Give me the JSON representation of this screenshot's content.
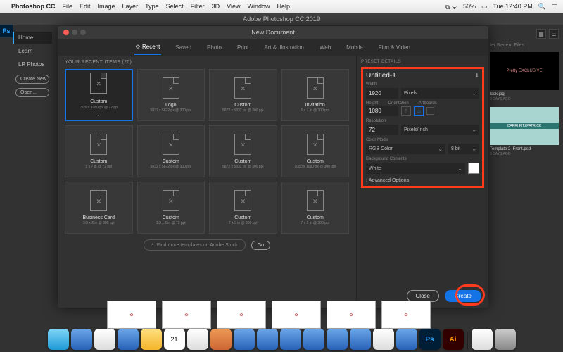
{
  "menubar": {
    "app": "Photoshop CC",
    "items": [
      "File",
      "Edit",
      "Image",
      "Layer",
      "Type",
      "Select",
      "Filter",
      "3D",
      "View",
      "Window",
      "Help"
    ],
    "battery": "50%",
    "time": "Tue 12:40 PM"
  },
  "titlebar": "Adobe Photoshop CC 2019",
  "sidebar": {
    "tabs": [
      "Home",
      "Learn",
      "LR Photos"
    ],
    "create": "Create New",
    "open": "Open..."
  },
  "dialog": {
    "title": "New Document",
    "tabs": [
      "Recent",
      "Saved",
      "Photo",
      "Print",
      "Art & Illustration",
      "Web",
      "Mobile",
      "Film & Video"
    ],
    "recent_header": "YOUR RECENT ITEMS  (20)",
    "presets": [
      {
        "n": "Custom",
        "d": "1920 x 1080 px @ 72 ppi"
      },
      {
        "n": "Logo",
        "d": "5832 x 5872 px @ 300 ppi"
      },
      {
        "n": "Custom",
        "d": "5872 x 5832 px @ 300 ppi"
      },
      {
        "n": "Invitation",
        "d": "5 x 7 in @ 300 ppi"
      },
      {
        "n": "Custom",
        "d": "5 x 7 in @ 72 ppi"
      },
      {
        "n": "Custom",
        "d": "5832 x 5872 px @ 300 ppi"
      },
      {
        "n": "Custom",
        "d": "5872 x 5832 px @ 300 ppi"
      },
      {
        "n": "Custom",
        "d": "1080 x 1080 px @ 300 ppi"
      },
      {
        "n": "Business Card",
        "d": "3.5 x 2 in @ 300 ppi"
      },
      {
        "n": "Custom",
        "d": "3.5 x 2 in @ 72 ppi"
      },
      {
        "n": "Custom",
        "d": "7 x 5 in @ 300 ppi"
      },
      {
        "n": "Custom",
        "d": "7 x 5 in @ 300 ppi"
      }
    ],
    "stock": {
      "placeholder": "Find more templates on Adobe Stock",
      "go": "Go"
    },
    "details": {
      "header": "PRESET DETAILS",
      "name": "Untitled-1",
      "width_label": "Width",
      "width": "1920",
      "width_unit": "Pixels",
      "height_label": "Height",
      "orient_label": "Orientation",
      "art_label": "Artboards",
      "height": "1080",
      "res_label": "Resolution",
      "res": "72",
      "res_unit": "Pixels/Inch",
      "cm_label": "Color Mode",
      "cm": "RGB Color",
      "depth": "8 bit",
      "bg_label": "Background Contents",
      "bg": "White",
      "adv": "Advanced Options"
    },
    "close": "Close",
    "create": "Create"
  },
  "rightpanel": {
    "filter": "ter Recent Files",
    "items": [
      {
        "name": "look.jpg",
        "ago": "3 DAYS AGO"
      },
      {
        "name": "Template 2_Front.psd",
        "ago": "9 DAYS AGO"
      }
    ],
    "thumb1": "Pretty EXCLUSIVE",
    "thumb2": "CARRI FITZPATRICK"
  }
}
